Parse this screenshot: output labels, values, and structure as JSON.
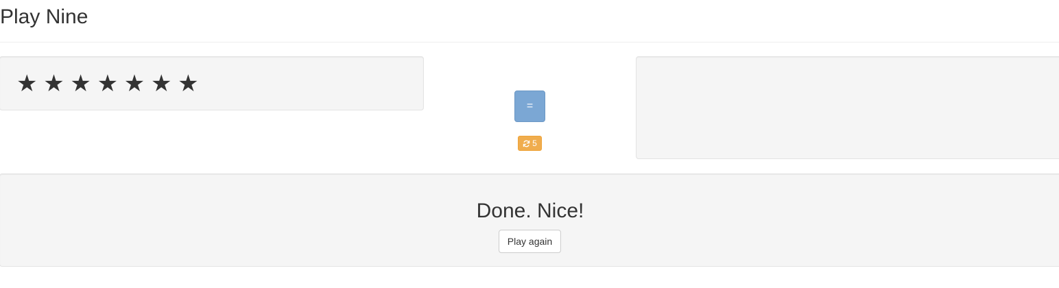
{
  "header": {
    "title": "Play Nine"
  },
  "stars": {
    "count": 7,
    "glyph": "★",
    "icon": "star-icon"
  },
  "controls": {
    "check_label": "=",
    "check_color": "#7ba7d4",
    "redraw_count": "5",
    "redraw_icon": "refresh-icon",
    "redraw_color": "#f0ad4e"
  },
  "answer": {
    "numbers": []
  },
  "result": {
    "message": "Done. Nice!",
    "play_again_label": "Play again"
  }
}
